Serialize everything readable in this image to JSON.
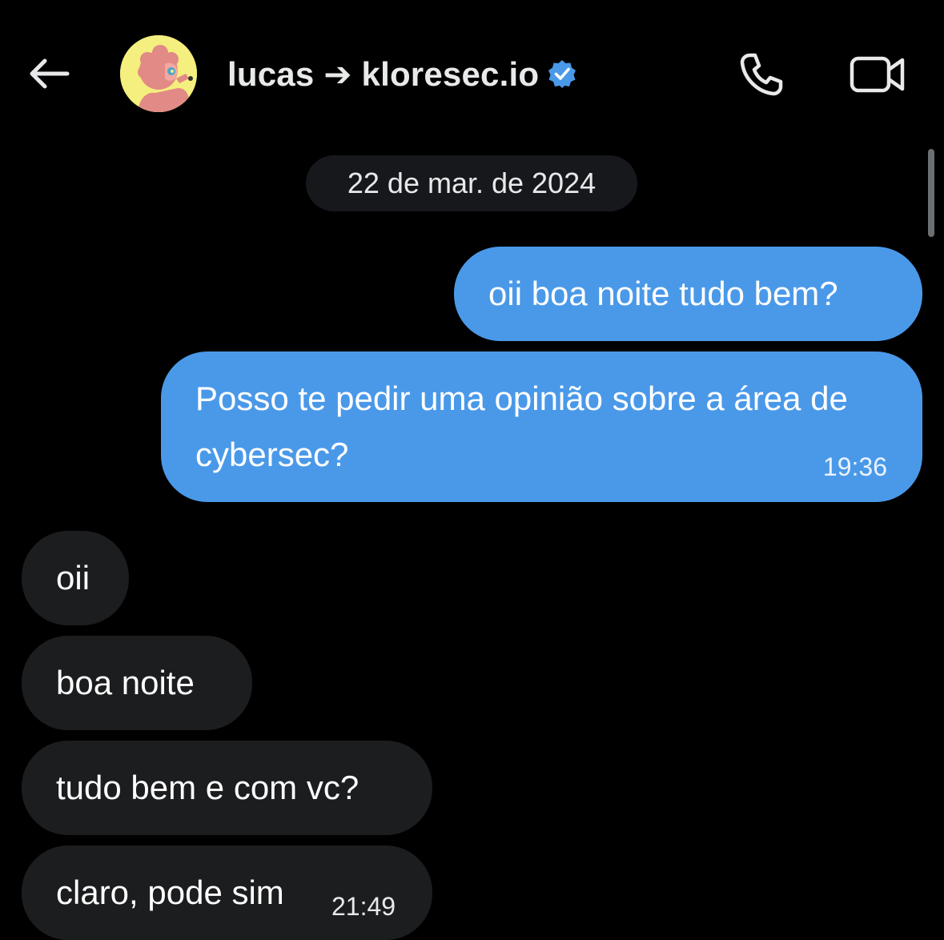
{
  "header": {
    "back_icon": "arrow-left-icon",
    "avatar_icon": "cartoon-avatar",
    "title": "lucas ➔ kloresec.io",
    "verified_icon": "verified-badge-icon",
    "call_icon": "phone-icon",
    "video_icon": "video-camera-icon"
  },
  "date_separator": "22 de mar. de 2024",
  "messages": [
    {
      "direction": "sent",
      "text": "oii boa noite tudo bem?",
      "time": ""
    },
    {
      "direction": "sent",
      "text": "Posso te pedir uma opinião sobre a área de cybersec?",
      "time": "19:36"
    },
    {
      "direction": "received",
      "text": "oii",
      "time": ""
    },
    {
      "direction": "received",
      "text": "boa noite",
      "time": ""
    },
    {
      "direction": "received",
      "text": "tudo bem e com vc?",
      "time": ""
    },
    {
      "direction": "received",
      "text": "claro, pode sim",
      "time": "21:49"
    }
  ],
  "colors": {
    "background": "#000000",
    "sent_bubble": "#4a99e9",
    "received_bubble": "#1c1d1f",
    "verified": "#4a99e9"
  }
}
